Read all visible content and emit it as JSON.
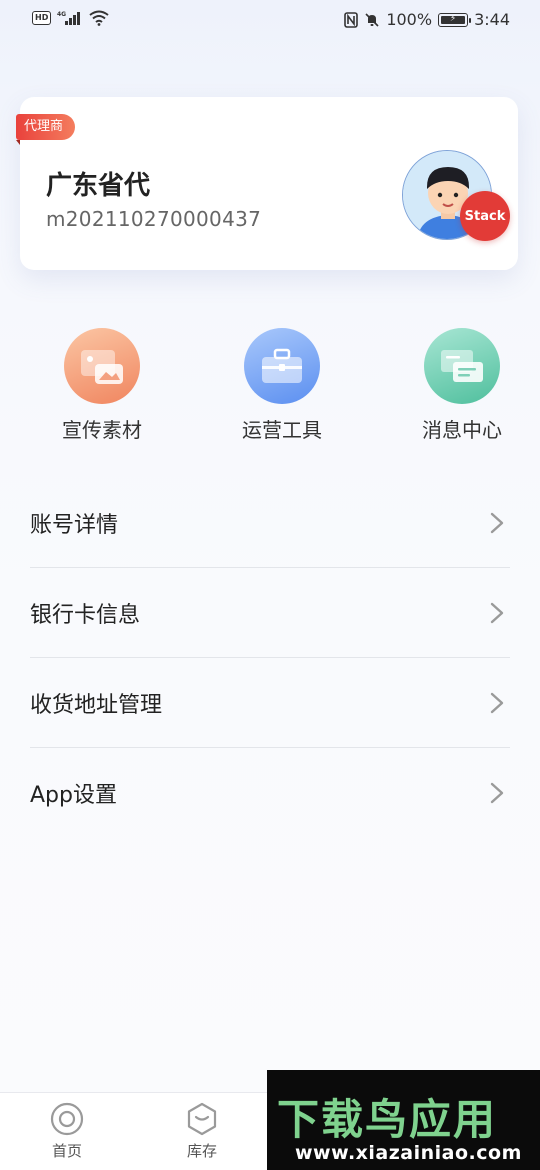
{
  "status_bar": {
    "hd": "HD",
    "network": "4G",
    "battery": "100%",
    "time": "3:44"
  },
  "profile": {
    "role_tag": "代理商",
    "name": "广东省代",
    "id": "m202110270000437",
    "avatar_badge": "Stack"
  },
  "quick_actions": [
    {
      "label": "宣传素材",
      "icon": "images-icon"
    },
    {
      "label": "运营工具",
      "icon": "toolbox-icon"
    },
    {
      "label": "消息中心",
      "icon": "message-icon"
    }
  ],
  "menu": [
    {
      "label": "账号详情"
    },
    {
      "label": "银行卡信息"
    },
    {
      "label": "收货地址管理"
    },
    {
      "label": "App设置"
    }
  ],
  "bottom_nav": [
    {
      "label": "首页",
      "icon": "home-icon"
    },
    {
      "label": "库存",
      "icon": "inventory-icon"
    }
  ],
  "watermark": {
    "title": "下载鸟应用",
    "url": "www.xiazainiao.com"
  },
  "colors": {
    "accent_red": "#e23b37",
    "orange": "#f0855f",
    "blue": "#5b8ff0",
    "green": "#4fbf9d"
  }
}
